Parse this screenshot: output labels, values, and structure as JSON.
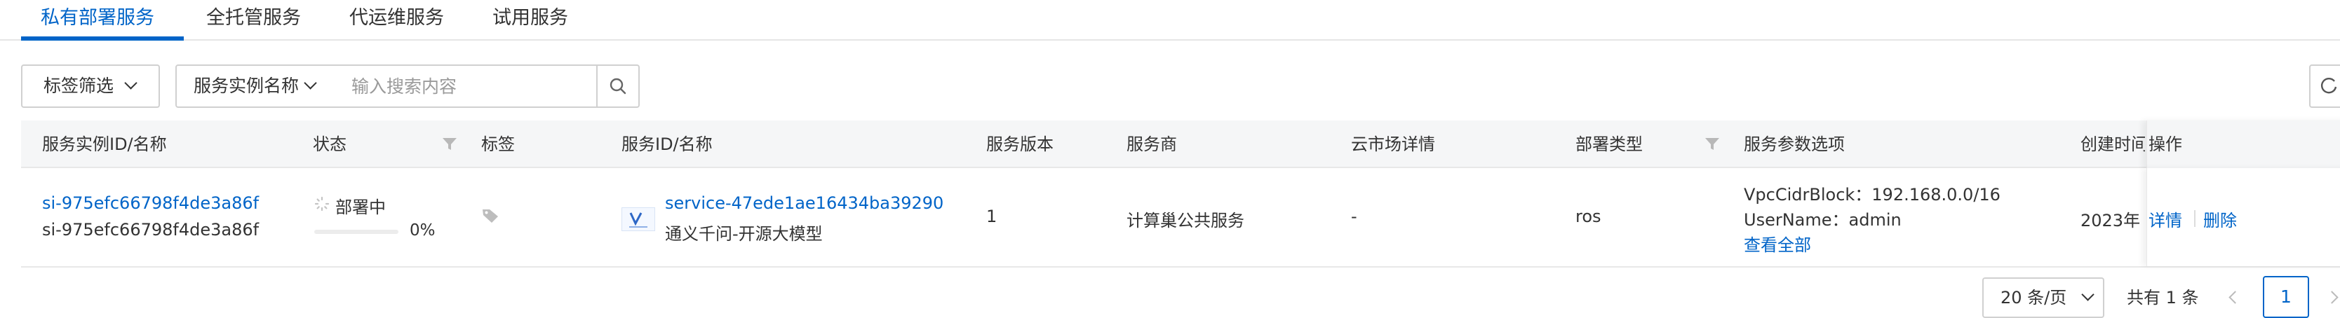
{
  "tabs": [
    {
      "label": "私有部署服务"
    },
    {
      "label": "全托管服务"
    },
    {
      "label": "代运维服务"
    },
    {
      "label": "试用服务"
    }
  ],
  "toolbar": {
    "tag_filter_label": "标签筛选",
    "field_select_label": "服务实例名称",
    "search_placeholder": "输入搜索内容"
  },
  "table": {
    "columns": [
      "服务实例ID/名称",
      "状态",
      "标签",
      "服务ID/名称",
      "服务版本",
      "服务商",
      "云市场详情",
      "部署类型",
      "服务参数选项",
      "创建时间",
      "操作"
    ],
    "rows": [
      {
        "instance_id": "si-975efc66798f4de3a86f",
        "instance_name": "si-975efc66798f4de3a86f",
        "status": "部署中",
        "progress_text": "0%",
        "progress_fraction": 0.0,
        "service_id": "service-47ede1ae16434ba39290",
        "service_name": "通义千问-开源大模型",
        "version": "1",
        "provider": "计算巢公共服务",
        "market": "-",
        "deploy_type": "ros",
        "param_1": "VpcCidrBlock：192.168.0.0/16",
        "param_2": "UserName：admin",
        "view_all": "查看全部",
        "created": "2023年",
        "action_detail": "详情",
        "action_delete": "删除"
      }
    ]
  },
  "pagination": {
    "page_size": "20 条/页",
    "total": "共有 1 条",
    "current_page": "1"
  },
  "colors": {
    "accent": "#0064c8",
    "header_bg": "#f5f6f7",
    "border": "#d0d0d0"
  }
}
